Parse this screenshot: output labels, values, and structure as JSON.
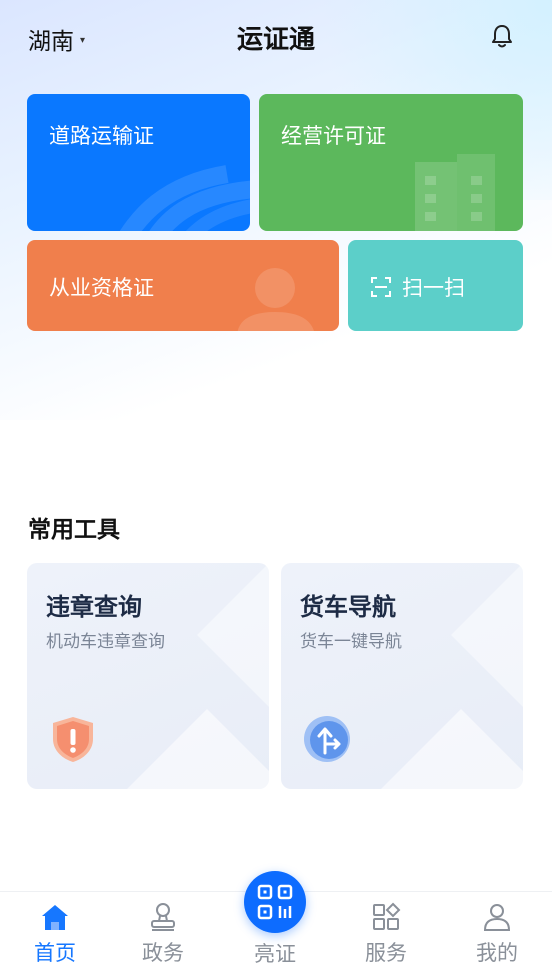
{
  "header": {
    "region": "湖南",
    "title": "运证通",
    "region_icon": "chevron-down-icon",
    "notification_icon": "bell-icon"
  },
  "cards": {
    "road_transport": {
      "label": "道路运输证",
      "color": "#0a78ff"
    },
    "business_license": {
      "label": "经营许可证",
      "color": "#5cb85c"
    },
    "qualification": {
      "label": "从业资格证",
      "color": "#f07f4c"
    },
    "scan": {
      "label": "扫一扫",
      "icon": "scan-icon",
      "color": "#5ccfc9"
    }
  },
  "tools": {
    "title": "常用工具",
    "items": [
      {
        "title": "违章查询",
        "subtitle": "机动车违章查询",
        "icon": "warning-shield-icon"
      },
      {
        "title": "货车导航",
        "subtitle": "货车一键导航",
        "icon": "navigation-icon"
      }
    ]
  },
  "tabbar": {
    "items": [
      {
        "label": "首页",
        "icon": "home-icon",
        "active": true
      },
      {
        "label": "政务",
        "icon": "stamp-icon",
        "active": false
      },
      {
        "label": "亮证",
        "icon": "qr-code-icon",
        "active": false
      },
      {
        "label": "服务",
        "icon": "grid-icon",
        "active": false
      },
      {
        "label": "我的",
        "icon": "user-icon",
        "active": false
      }
    ],
    "accent": "#1677ff"
  }
}
